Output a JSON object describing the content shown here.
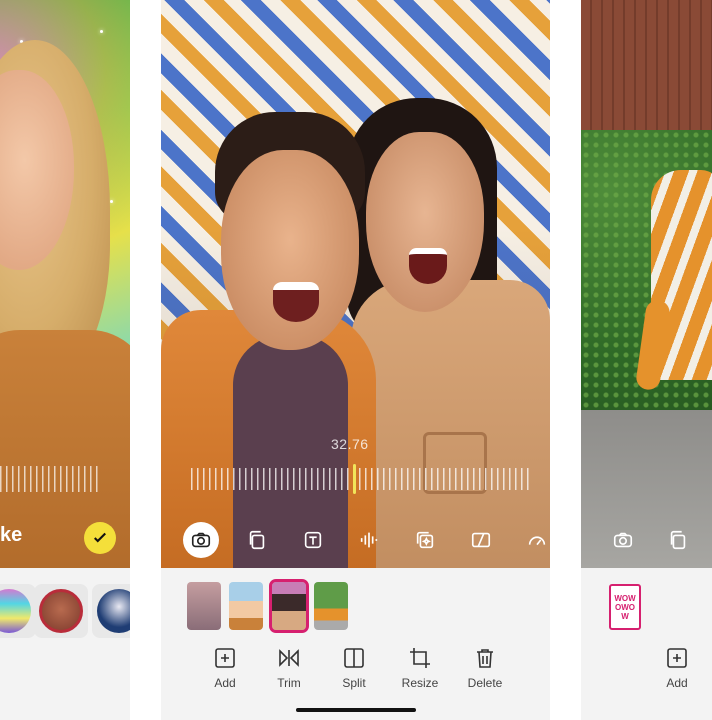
{
  "left_panel": {
    "effect_label": "ke",
    "confirm_icon": "check-icon",
    "confirm_color": "#f4df3a"
  },
  "center_panel": {
    "timestamp": "32.76",
    "playhead_color": "#f1e55a",
    "tools": [
      {
        "name": "camera-icon",
        "active": true
      },
      {
        "name": "layers-icon",
        "active": false
      },
      {
        "name": "text-icon",
        "active": false
      },
      {
        "name": "audio-icon",
        "active": false
      },
      {
        "name": "sticker-icon",
        "active": false
      },
      {
        "name": "ratio-icon",
        "active": false
      },
      {
        "name": "speed-icon",
        "active": false
      }
    ],
    "clips_selected_index": 2,
    "selection_color": "#d6206f",
    "actions": [
      {
        "label": "Add",
        "icon": "add-square-icon"
      },
      {
        "label": "Trim",
        "icon": "trim-icon"
      },
      {
        "label": "Split",
        "icon": "split-icon"
      },
      {
        "label": "Resize",
        "icon": "crop-icon"
      },
      {
        "label": "Delete",
        "icon": "trash-icon"
      }
    ]
  },
  "right_panel": {
    "sticker_text": "WOW\nOWO\nW",
    "actions": [
      {
        "label": "Add",
        "icon": "add-square-icon"
      }
    ]
  }
}
